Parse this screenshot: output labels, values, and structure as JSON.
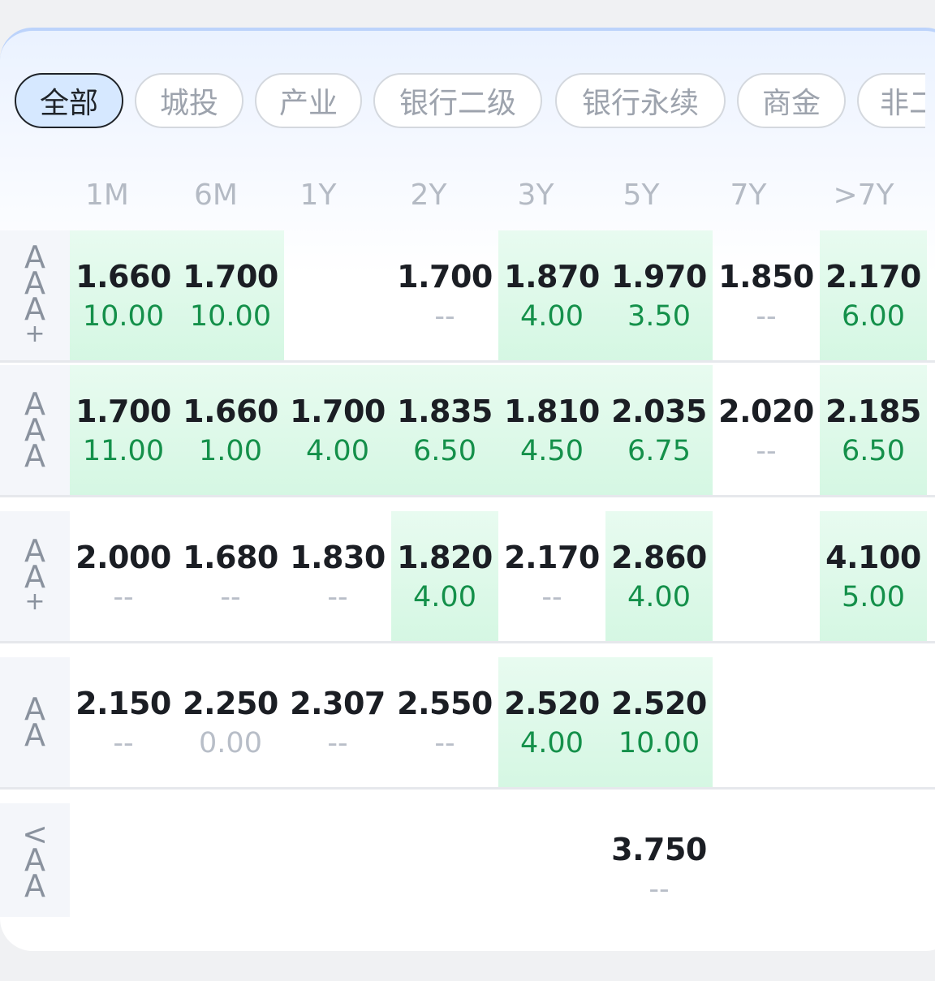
{
  "tabs": [
    {
      "label": "全部",
      "active": true
    },
    {
      "label": "城投",
      "active": false
    },
    {
      "label": "产业",
      "active": false
    },
    {
      "label": "银行二级",
      "active": false
    },
    {
      "label": "银行永续",
      "active": false
    },
    {
      "label": "商金",
      "active": false
    },
    {
      "label": "非二",
      "active": false
    }
  ],
  "columns": [
    "1M",
    "6M",
    "1Y",
    "2Y",
    "3Y",
    "5Y",
    "7Y",
    ">7Y"
  ],
  "rows": [
    {
      "label": [
        "A",
        "A",
        "A",
        "+"
      ],
      "cells": [
        {
          "rate": "1.660",
          "vol": "10.00",
          "highlight": true
        },
        {
          "rate": "1.700",
          "vol": "10.00",
          "highlight": true
        },
        null,
        {
          "rate": "1.700",
          "vol": "--",
          "highlight": false
        },
        {
          "rate": "1.870",
          "vol": "4.00",
          "highlight": true
        },
        {
          "rate": "1.970",
          "vol": "3.50",
          "highlight": true
        },
        {
          "rate": "1.850",
          "vol": "--",
          "highlight": false
        },
        {
          "rate": "2.170",
          "vol": "6.00",
          "highlight": true
        }
      ]
    },
    {
      "label": [
        "A",
        "A",
        "A"
      ],
      "cells": [
        {
          "rate": "1.700",
          "vol": "11.00",
          "highlight": true
        },
        {
          "rate": "1.660",
          "vol": "1.00",
          "highlight": true
        },
        {
          "rate": "1.700",
          "vol": "4.00",
          "highlight": true
        },
        {
          "rate": "1.835",
          "vol": "6.50",
          "highlight": true
        },
        {
          "rate": "1.810",
          "vol": "4.50",
          "highlight": true
        },
        {
          "rate": "2.035",
          "vol": "6.75",
          "highlight": true
        },
        {
          "rate": "2.020",
          "vol": "--",
          "highlight": false
        },
        {
          "rate": "2.185",
          "vol": "6.50",
          "highlight": true
        }
      ]
    },
    {
      "label": [
        "A",
        "A",
        "+"
      ],
      "cells": [
        {
          "rate": "2.000",
          "vol": "--",
          "highlight": false
        },
        {
          "rate": "1.680",
          "vol": "--",
          "highlight": false
        },
        {
          "rate": "1.830",
          "vol": "--",
          "highlight": false
        },
        {
          "rate": "1.820",
          "vol": "4.00",
          "highlight": true
        },
        {
          "rate": "2.170",
          "vol": "--",
          "highlight": false
        },
        {
          "rate": "2.860",
          "vol": "4.00",
          "highlight": true
        },
        null,
        {
          "rate": "4.100",
          "vol": "5.00",
          "highlight": true
        }
      ]
    },
    {
      "label": [
        "A",
        "A"
      ],
      "cells": [
        {
          "rate": "2.150",
          "vol": "--",
          "highlight": false
        },
        {
          "rate": "2.250",
          "vol": "0.00",
          "highlight": false
        },
        {
          "rate": "2.307",
          "vol": "--",
          "highlight": false
        },
        {
          "rate": "2.550",
          "vol": "--",
          "highlight": false
        },
        {
          "rate": "2.520",
          "vol": "4.00",
          "highlight": true
        },
        {
          "rate": "2.520",
          "vol": "10.00",
          "highlight": true
        },
        null,
        null
      ]
    },
    {
      "label": [
        "<",
        "A",
        "A"
      ],
      "cells": [
        null,
        null,
        null,
        null,
        null,
        {
          "rate": "3.750",
          "vol": "--",
          "highlight": false
        },
        null,
        null
      ]
    }
  ],
  "colors": {
    "highlight_bg": "#d9f8e6",
    "volume_green": "#14904a",
    "muted": "#b8bec8",
    "active_tab_bg": "#d6e8ff"
  }
}
